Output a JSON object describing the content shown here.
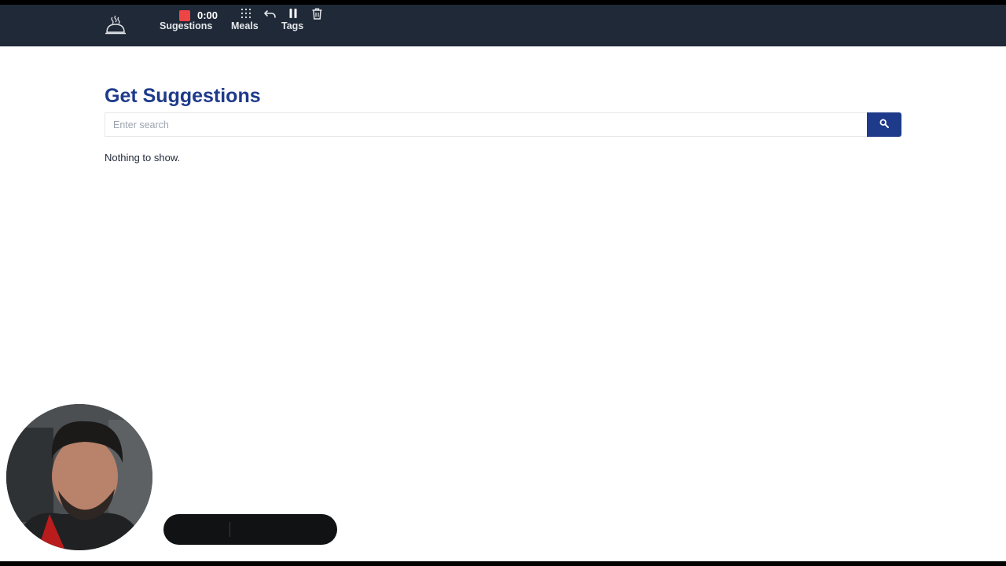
{
  "nav": {
    "logo_icon": "cloche-icon",
    "links": [
      "Sugestions",
      "Meals",
      "Tags"
    ]
  },
  "page": {
    "title": "Get Suggestions",
    "search_placeholder": "Enter search",
    "search_value": "",
    "search_icon": "search-icon",
    "empty_message": "Nothing to show."
  },
  "recorder": {
    "time": "0:00",
    "icons": [
      "stop-icon",
      "grid-icon",
      "undo-icon",
      "pause-icon",
      "trash-icon"
    ]
  },
  "colors": {
    "navbar": "#1f2937",
    "title": "#1e3a8a",
    "search_button": "#1e3a8a",
    "record_stop": "#ef4444"
  }
}
